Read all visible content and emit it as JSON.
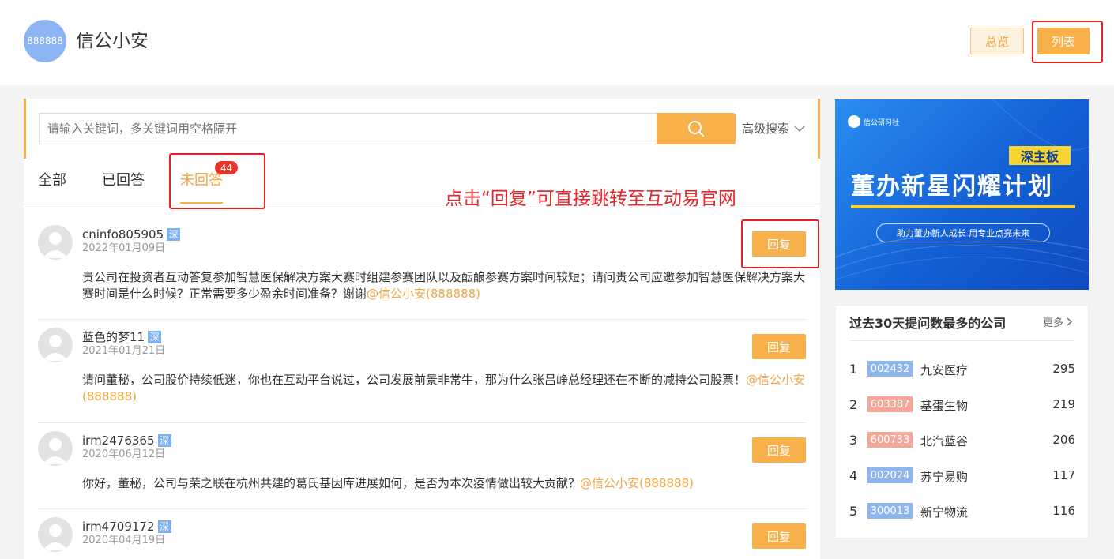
{
  "header": {
    "avatar_text": "888888",
    "company_name": "信公小安",
    "overview_button": "总览",
    "list_button": "列表"
  },
  "search": {
    "placeholder": "请输入关键词，多关键词用空格隔开",
    "advanced": "高级搜索"
  },
  "tabs": [
    {
      "label": "全部"
    },
    {
      "label": "已回答"
    },
    {
      "label": "未回答",
      "badge": "44",
      "active": true
    }
  ],
  "annotation": "点击“回复”可直接跳转至互动易官网",
  "questions": [
    {
      "user": "cninfo805905",
      "exchange": "深",
      "date": "2022年01月09日",
      "text": "贵公司在投资者互动答复参加智慧医保解决方案大赛时组建参赛团队以及酝酿参赛方案时间较短；请问贵公司应邀参加智慧医保解决方案大赛时间是什么时候？正常需要多少盈余时间准备？谢谢",
      "mention": "@信公小安(888888)",
      "reply": "回复"
    },
    {
      "user": "蓝色的梦11",
      "exchange": "深",
      "date": "2021年01月21日",
      "text": "请问董秘，公司股价持续低迷，你也在互动平台说过，公司发展前景非常牛，那为什么张吕峥总经理还在不断的减持公司股票！",
      "mention": "@信公小安(888888)",
      "reply": "回复"
    },
    {
      "user": "irm2476365",
      "exchange": "深",
      "date": "2020年06月12日",
      "text": "你好，董秘，公司与荣之联在杭州共建的葛氏基因库进展如何，是否为本次疫情做出较大贡献？",
      "mention": "@信公小安(888888)",
      "reply": "回复"
    },
    {
      "user": "irm4709172",
      "exchange": "深",
      "date": "2020年04月19日",
      "text": "",
      "mention": "",
      "reply": "回复"
    }
  ],
  "banner": {
    "logo_text": "信公研习社",
    "tag": "深主板",
    "title": "董办新星闪耀计划",
    "slogan": "助力董办新人成长 用专业点亮未来"
  },
  "ranking": {
    "title": "过去30天提问数最多的公司",
    "more": "更多",
    "items": [
      {
        "rank": "1",
        "code": "002432",
        "name": "九安医疗",
        "count": "295",
        "color": "#8fb5ee"
      },
      {
        "rank": "2",
        "code": "603387",
        "name": "基蛋生物",
        "count": "219",
        "color": "#f5a89a"
      },
      {
        "rank": "3",
        "code": "600733",
        "name": "北汽蓝谷",
        "count": "206",
        "color": "#f5a89a"
      },
      {
        "rank": "4",
        "code": "002024",
        "name": "苏宁易购",
        "count": "117",
        "color": "#8fb5ee"
      },
      {
        "rank": "5",
        "code": "300013",
        "name": "新宁物流",
        "count": "116",
        "color": "#8fb5ee"
      }
    ]
  }
}
